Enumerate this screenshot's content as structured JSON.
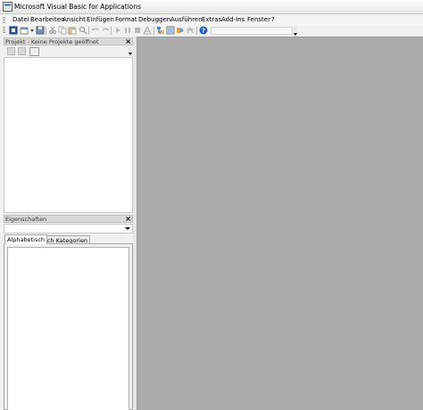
{
  "window": {
    "title": "Microsoft Visual Basic for Applications",
    "icon": "vba-app-icon"
  },
  "menu": {
    "items": [
      "Datei",
      "Bearbeiten",
      "Ansicht",
      "Einfügen",
      "Format",
      "Debuggen",
      "Ausführen",
      "Extras",
      "Add-Ins",
      "Fenster",
      "?"
    ]
  },
  "toolbar": {
    "buttons": [
      "view-excel-icon",
      "insert-userform-icon",
      "save-icon",
      "cut-icon",
      "copy-icon",
      "paste-icon",
      "find-icon",
      "undo-icon",
      "redo-icon",
      "run-icon",
      "break-icon",
      "reset-icon",
      "design-mode-icon",
      "project-explorer-icon",
      "properties-window-icon",
      "object-browser-icon",
      "toolbox-icon",
      "help-icon"
    ],
    "accent": "#1f5fbf"
  },
  "project_panel": {
    "title": "Projekt - Keine Projekte geöffnet",
    "close": "×",
    "buttons": [
      "view-code-icon",
      "view-object-icon",
      "toggle-folders-icon"
    ]
  },
  "properties_panel": {
    "title": "Eigenschaften",
    "close": "×",
    "tabs": [
      "Alphabetisch",
      "Nach Kategorien"
    ],
    "active_tab": "Alphabetisch"
  },
  "workspace": {
    "background": "#ababab"
  }
}
